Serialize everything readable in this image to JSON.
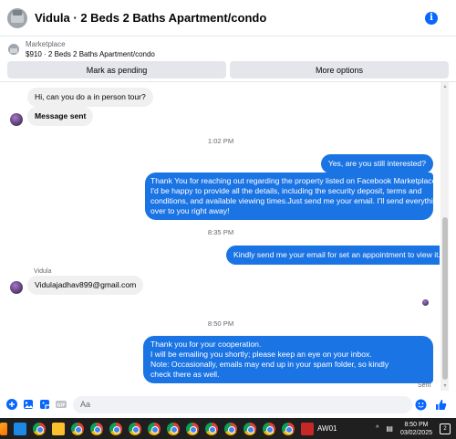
{
  "header": {
    "title": "Vidula · 2 Beds 2 Baths Apartment/condo",
    "info_icon": "info-icon"
  },
  "listing": {
    "section": "Marketplace",
    "summary": "$910 · 2 Beds 2 Baths Apartment/condo"
  },
  "actions": {
    "mark_pending": "Mark as pending",
    "more_options": "More options"
  },
  "messages": {
    "m1": "Hi, can you do a in person tour?",
    "m2": "Message sent",
    "t1": "1:02 PM",
    "m3": "Yes, are you still interested?",
    "m4_l1": "Thank You for reaching out regarding the property listed on Facebook Marketplace.",
    "m4_l2": "I'd be happy to provide all the details, including the security deposit, terms and",
    "m4_l3": "conditions, and available viewing times.Just send me your email. I'll send everything",
    "m4_l4": "over to you right away!",
    "t2": "8:35 PM",
    "m5": "Kindly send me your email for set an appointment to view it.",
    "sender": "Vidula",
    "m6": "Vidulajadhav899@gmail.com",
    "t3": "8:50 PM",
    "m7_l1": "Thank you for your cooperation.",
    "m7_l2": "I will be emailing you shortly; please keep an eye on your inbox.",
    "m7_l3": "Note: Occasionally, emails may end up in your spam folder, so kindly",
    "m7_l4": "check there as well.",
    "status": "Sent"
  },
  "composer": {
    "placeholder": "Aa"
  },
  "taskbar": {
    "weather": "AW01",
    "time": "8:50 PM",
    "date": "03/02/2025",
    "notifications": "2"
  },
  "colors": {
    "accent": "#1b74e4",
    "incoming_bubble": "#f0f0f0"
  }
}
